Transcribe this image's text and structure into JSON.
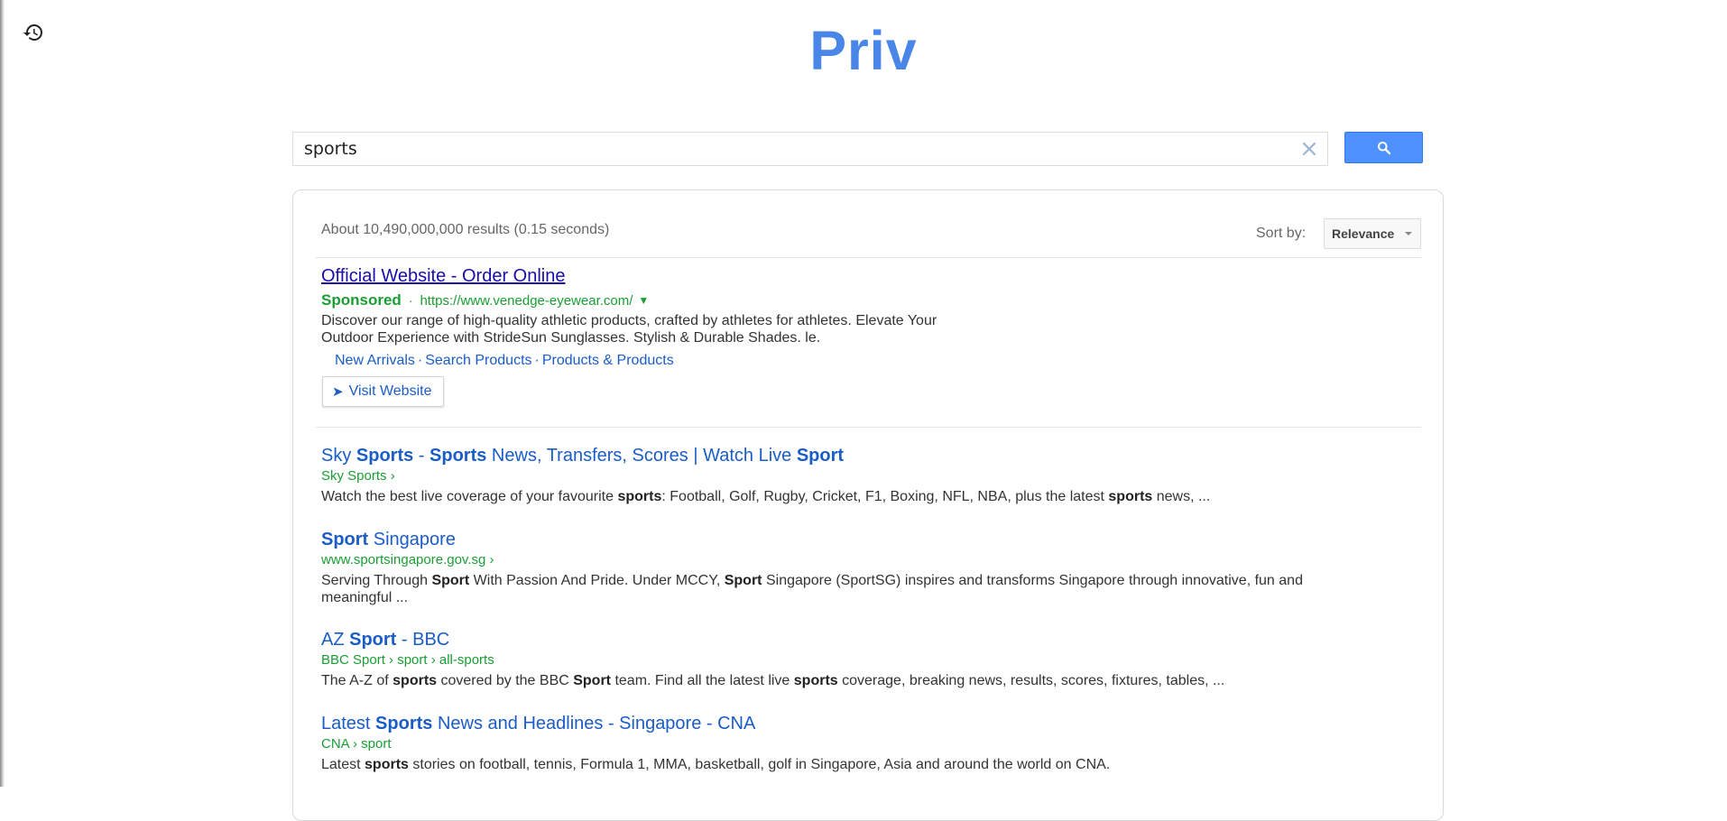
{
  "logo": "Priv",
  "search": {
    "value": "sports",
    "placeholder": ""
  },
  "results_info": {
    "stats": "About 10,490,000,000 results (0.15 seconds)",
    "sort_label": "Sort by:",
    "sort_value": "Relevance"
  },
  "ad": {
    "title": "Official Website - Order Online",
    "sponsored": "Sponsored",
    "dot": "·",
    "url": "https://www.venedge-eyewear.com/",
    "arrow": "▼",
    "description": "Discover our range of high-quality athletic products, crafted by athletes for athletes. Elevate Your Outdoor Experience with StrideSun Sunglasses. Stylish & Durable Shades. le.",
    "sitelinks": [
      "New Arrivals",
      "Search Products",
      "Products & Products"
    ],
    "sitelink_separator": "·",
    "visit_label": "Visit Website"
  },
  "results": [
    {
      "title_parts": [
        {
          "text": "Sky ",
          "bold": false
        },
        {
          "text": "Sports",
          "bold": true
        },
        {
          "text": " - ",
          "bold": false
        },
        {
          "text": "Sports",
          "bold": true
        },
        {
          "text": " News, Transfers, Scores | Watch Live ",
          "bold": false
        },
        {
          "text": "Sport",
          "bold": true
        }
      ],
      "url": "Sky Sports ›",
      "snippet_parts": [
        {
          "text": "Watch the best live coverage of your favourite ",
          "bold": false
        },
        {
          "text": "sports",
          "bold": true
        },
        {
          "text": ": Football, Golf, Rugby, Cricket, F1, Boxing, NFL, NBA, plus the latest ",
          "bold": false
        },
        {
          "text": "sports",
          "bold": true
        },
        {
          "text": " news, ...",
          "bold": false
        }
      ]
    },
    {
      "title_parts": [
        {
          "text": "Sport",
          "bold": true
        },
        {
          "text": " Singapore",
          "bold": false
        }
      ],
      "url": "www.sportsingapore.gov.sg ›",
      "snippet_parts": [
        {
          "text": "Serving Through ",
          "bold": false
        },
        {
          "text": "Sport",
          "bold": true
        },
        {
          "text": " With Passion And Pride. Under MCCY, ",
          "bold": false
        },
        {
          "text": "Sport",
          "bold": true
        },
        {
          "text": " Singapore (SportSG) inspires and transforms Singapore through innovative, fun and meaningful ...",
          "bold": false
        }
      ]
    },
    {
      "title_parts": [
        {
          "text": "AZ ",
          "bold": false
        },
        {
          "text": "Sport",
          "bold": true
        },
        {
          "text": " - BBC",
          "bold": false
        }
      ],
      "url": "BBC Sport › sport › all-sports",
      "snippet_parts": [
        {
          "text": "The A-Z of ",
          "bold": false
        },
        {
          "text": "sports",
          "bold": true
        },
        {
          "text": " covered by the BBC ",
          "bold": false
        },
        {
          "text": "Sport",
          "bold": true
        },
        {
          "text": " team. Find all the latest live ",
          "bold": false
        },
        {
          "text": "sports",
          "bold": true
        },
        {
          "text": " coverage, breaking news, results, scores, fixtures, tables, ...",
          "bold": false
        }
      ]
    },
    {
      "title_parts": [
        {
          "text": "Latest ",
          "bold": false
        },
        {
          "text": "Sports",
          "bold": true
        },
        {
          "text": " News and Headlines - Singapore - CNA",
          "bold": false
        }
      ],
      "url": "CNA › sport",
      "snippet_parts": [
        {
          "text": "Latest ",
          "bold": false
        },
        {
          "text": "sports",
          "bold": true
        },
        {
          "text": " stories on football, tennis, Formula 1, MMA, basketball, golf in Singapore, Asia and around the world on CNA.",
          "bold": false
        }
      ]
    }
  ],
  "colors": {
    "logo": "#4a86e8",
    "link": "#1a5dc7",
    "ad_title": "#1a0dab",
    "url_green": "#1a9e34",
    "search_button": "#4d90fe"
  },
  "icons": {
    "history": "history-icon",
    "clear": "close-icon",
    "search": "search-icon"
  }
}
